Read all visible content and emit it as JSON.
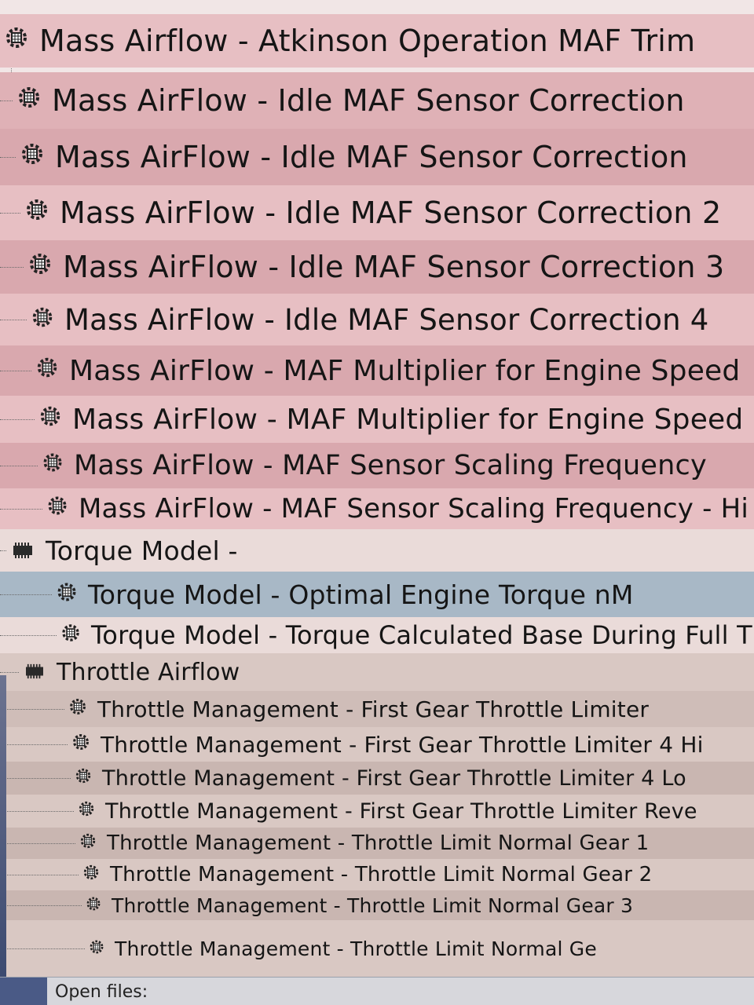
{
  "tree": {
    "items": [
      {
        "label": "Mass Airflow - Atkinson Operation MAF Trim",
        "icon": "table-gear-icon"
      },
      {
        "label": "Mass AirFlow - Idle MAF Sensor Correction",
        "icon": "table-gear-icon"
      },
      {
        "label": "Mass AirFlow - Idle MAF Sensor Correction",
        "icon": "table-gear-icon"
      },
      {
        "label": "Mass AirFlow - Idle MAF Sensor Correction 2",
        "icon": "table-gear-icon"
      },
      {
        "label": "Mass AirFlow - Idle MAF Sensor Correction 3",
        "icon": "table-gear-icon"
      },
      {
        "label": "Mass AirFlow - Idle MAF Sensor Correction 4",
        "icon": "table-gear-icon"
      },
      {
        "label": "Mass AirFlow - MAF Multiplier for Engine Speed",
        "icon": "table-gear-icon"
      },
      {
        "label": "Mass AirFlow - MAF Multiplier for Engine Speed a",
        "icon": "table-gear-icon"
      },
      {
        "label": "Mass AirFlow - MAF Sensor Scaling Frequency",
        "icon": "table-gear-icon"
      },
      {
        "label": "Mass AirFlow - MAF Sensor Scaling Frequency - Hi",
        "icon": "table-gear-icon"
      },
      {
        "label": "Torque Model -",
        "icon": "folder-chip-icon"
      },
      {
        "label": "Torque Model - Optimal Engine Torque nM",
        "icon": "table-gear-icon"
      },
      {
        "label": "Torque Model - Torque Calculated Base During Full T",
        "icon": "table-gear-icon"
      },
      {
        "label": "Throttle Airflow",
        "icon": "folder-chip-icon"
      },
      {
        "label": "Throttle Management - First Gear Throttle Limiter",
        "icon": "table-gear-icon"
      },
      {
        "label": "Throttle Management - First Gear Throttle Limiter 4 Hi",
        "icon": "table-gear-icon"
      },
      {
        "label": "Throttle Management - First Gear Throttle Limiter 4 Lo",
        "icon": "table-gear-icon"
      },
      {
        "label": "Throttle Management - First Gear Throttle Limiter Reve",
        "icon": "table-gear-icon"
      },
      {
        "label": "Throttle Management - Throttle Limit Normal Gear 1",
        "icon": "table-gear-icon"
      },
      {
        "label": "Throttle Management - Throttle Limit Normal Gear 2",
        "icon": "table-gear-icon"
      },
      {
        "label": "Throttle Management - Throttle Limit Normal Gear 3",
        "icon": "table-gear-icon"
      },
      {
        "label": "Throttle Management - Throttle Limit Normal Ge",
        "icon": "table-gear-icon"
      }
    ],
    "selected_label": "Torque Model - Optimal Engine Torque nM"
  },
  "statusbar": {
    "label": "Open files:"
  },
  "colors": {
    "row_pink": "#e7bfc3",
    "row_selected": "#a8b8c6",
    "row_tan": "#d9c8c3",
    "text": "#151515"
  }
}
